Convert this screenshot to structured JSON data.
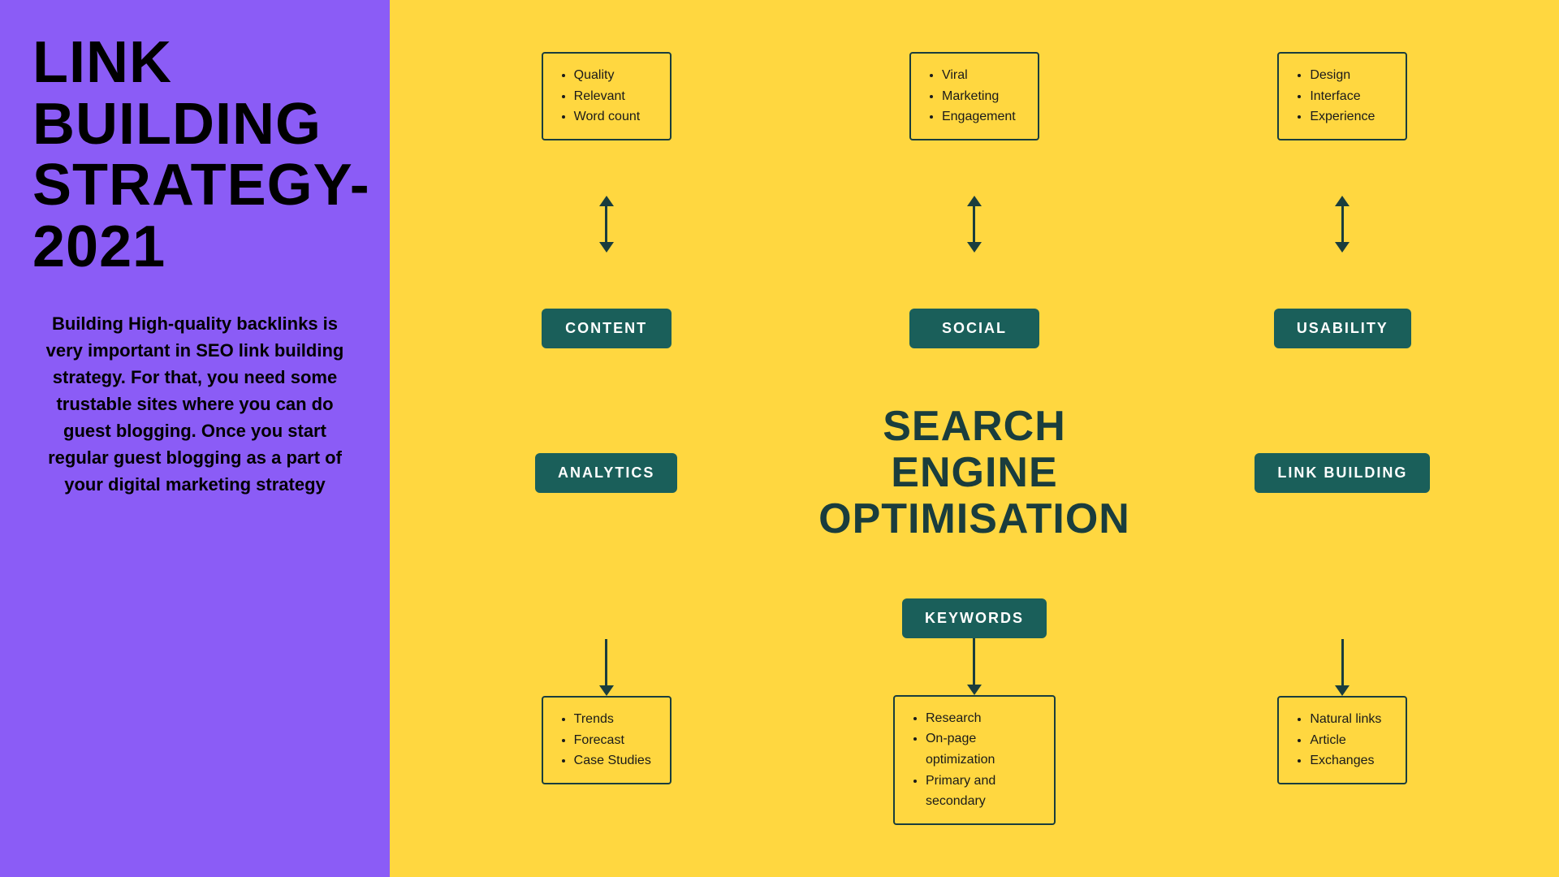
{
  "left": {
    "title": "LINK\nBUILDING\nSTRATEGY-2021",
    "description": "Building High-quality backlinks is very important in SEO link building strategy. For that, you need some trustable sites where you can do guest blogging. Once you start regular guest blogging as a part of your digital marketing strategy"
  },
  "diagram": {
    "seo_title_line1": "SEARCH ENGINE",
    "seo_title_line2": "OPTIMISATION",
    "col1": {
      "top_box": {
        "items": [
          "Quality",
          "Relevant",
          "Word count"
        ]
      },
      "top_label": "CONTENT",
      "bottom_label": "ANALYTICS",
      "bottom_box": {
        "items": [
          "Trends",
          "Forecast",
          "Case Studies"
        ]
      }
    },
    "col2": {
      "top_label": "SOCIAL",
      "top_box": {
        "items": [
          "Viral",
          "Marketing",
          "Engagement"
        ]
      },
      "bottom_label": "KEYWORDS",
      "bottom_box": {
        "items": [
          "Research",
          "On-page optimization",
          "Primary and secondary"
        ]
      }
    },
    "col3": {
      "top_box": {
        "items": [
          "Design",
          "Interface",
          "Experience"
        ]
      },
      "top_label": "USABILITY",
      "bottom_label": "LINK BUILDING",
      "bottom_box": {
        "items": [
          "Natural links",
          "Article",
          "Exchanges"
        ]
      }
    }
  }
}
